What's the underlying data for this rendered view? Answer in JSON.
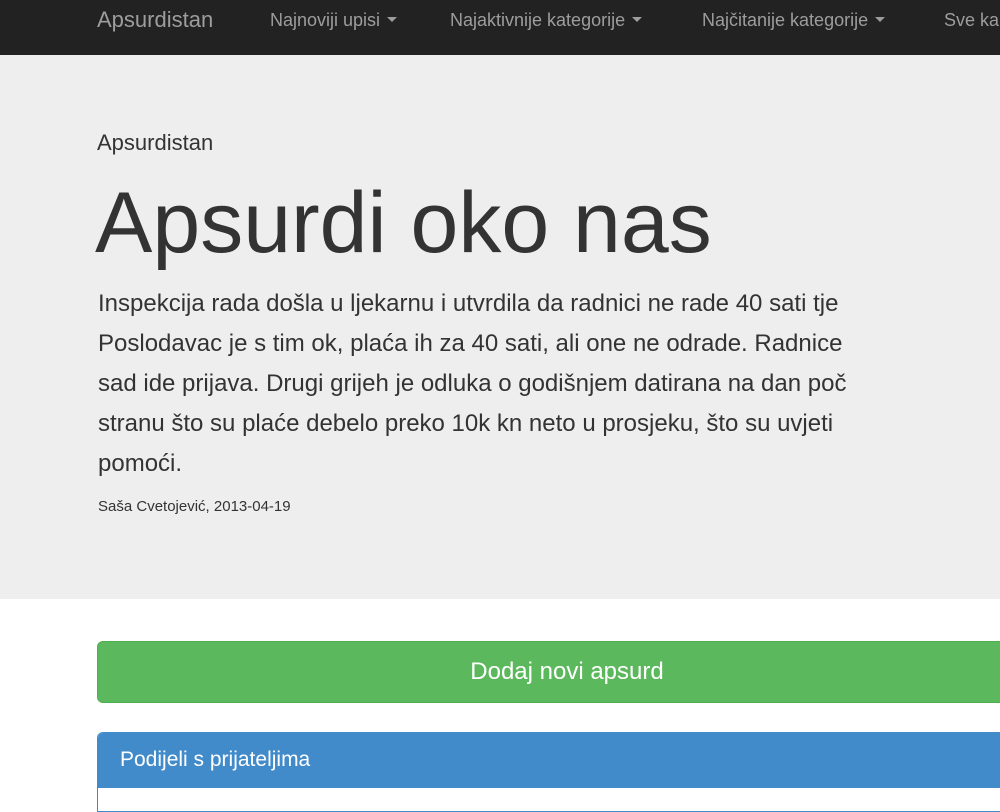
{
  "navbar": {
    "brand": "Apsurdistan",
    "items": [
      {
        "label": "Najnoviji upisi",
        "has_caret": true
      },
      {
        "label": "Najaktivnije kategorije",
        "has_caret": true
      },
      {
        "label": "Najčitanije kategorije",
        "has_caret": true
      },
      {
        "label": "Sve ka",
        "has_caret": false
      }
    ]
  },
  "jumbotron": {
    "site_name": "Apsurdistan",
    "title": "Apsurdi oko nas",
    "lead_lines": [
      "Inspekcija rada došla u ljekarnu i utvrdila da radnici ne rade 40 sati tje",
      "Poslodavac je s tim ok, plaća ih za 40 sati, ali one ne odrade. Radnice",
      "sad ide prijava. Drugi grijeh je odluka o godišnjem datirana na dan poč",
      "stranu što su plaće debelo preko 10k kn neto u prosjeku, što su uvjeti",
      "pomoći."
    ],
    "byline": "Saša Cvetojević, 2013-04-19"
  },
  "add_button": {
    "label": "Dodaj novi apsurd"
  },
  "share_panel": {
    "heading": "Podijeli s prijateljima"
  },
  "colors": {
    "navbar_bg": "#222222",
    "jumbotron_bg": "#eeeeee",
    "success_green": "#5cb85c",
    "primary_blue": "#428bca"
  }
}
